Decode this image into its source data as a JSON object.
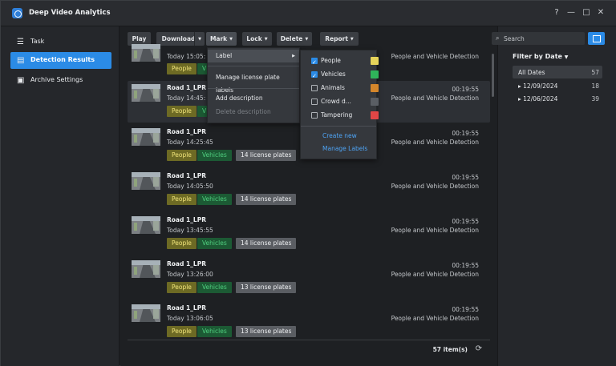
{
  "window": {
    "title": "Deep Video Analytics",
    "help": "?",
    "minimize": "—",
    "maximize": "□",
    "close": "✕"
  },
  "sidebar": {
    "items": [
      {
        "label": "Task",
        "icon": "list-icon"
      },
      {
        "label": "Detection Results",
        "icon": "document-icon",
        "active": true
      },
      {
        "label": "Archive Settings",
        "icon": "archive-icon"
      }
    ]
  },
  "toolbar": {
    "play": "Play",
    "download": "Download",
    "mark": "Mark",
    "lock": "Lock",
    "delete": "Delete",
    "report": "Report"
  },
  "search": {
    "placeholder": "Search"
  },
  "events": [
    {
      "title": "",
      "time": "Today 15:05:",
      "duration": "",
      "type": "People and Vehicle Detection",
      "people": "People",
      "vehicles": "V",
      "plates": ""
    },
    {
      "title": "Road 1_LPR",
      "time": "Today 14:45:",
      "duration": "00:19:55",
      "type": "People and Vehicle Detection",
      "people": "People",
      "vehicles": "V",
      "plates": ""
    },
    {
      "title": "Road 1_LPR",
      "time": "Today 14:25:45",
      "duration": "00:19:55",
      "type": "People and Vehicle Detection",
      "people": "People",
      "vehicles": "Vehicles",
      "plates": "14 license plates"
    },
    {
      "title": "Road 1_LPR",
      "time": "Today 14:05:50",
      "duration": "00:19:55",
      "type": "People and Vehicle Detection",
      "people": "People",
      "vehicles": "Vehicles",
      "plates": "14 license plates"
    },
    {
      "title": "Road 1_LPR",
      "time": "Today 13:45:55",
      "duration": "00:19:55",
      "type": "People and Vehicle Detection",
      "people": "People",
      "vehicles": "Vehicles",
      "plates": "14 license plates"
    },
    {
      "title": "Road 1_LPR",
      "time": "Today 13:26:00",
      "duration": "00:19:55",
      "type": "People and Vehicle Detection",
      "people": "People",
      "vehicles": "Vehicles",
      "plates": "13 license plates"
    },
    {
      "title": "Road 1_LPR",
      "time": "Today 13:06:05",
      "duration": "00:19:55",
      "type": "People and Vehicle Detection",
      "people": "People",
      "vehicles": "Vehicles",
      "plates": "13 license plates"
    }
  ],
  "footer": {
    "count": "57 item(s)"
  },
  "filter": {
    "title": "Filter by Date",
    "dates": [
      {
        "label": "All Dates",
        "count": "57",
        "active": true
      },
      {
        "label": "▸ 12/09/2024",
        "count": "18"
      },
      {
        "label": "▸ 12/06/2024",
        "count": "39"
      }
    ]
  },
  "mark_menu": {
    "label": "Label",
    "manage_plates": "Manage license plate labels",
    "add_description": "Add description",
    "delete_description": "Delete description"
  },
  "label_menu": {
    "items": [
      {
        "name": "People",
        "checked": true,
        "color": "#e6d35a"
      },
      {
        "name": "Vehicles",
        "checked": true,
        "color": "#2fb45a"
      },
      {
        "name": "Animals",
        "checked": false,
        "color": "#d4862b"
      },
      {
        "name": "Crowd d...",
        "checked": false,
        "color": "#5a5e64"
      },
      {
        "name": "Tampering",
        "checked": false,
        "color": "#e04646"
      }
    ],
    "create_new": "Create new",
    "manage_labels": "Manage Labels"
  },
  "colors": {
    "accent": "#2b8be6"
  }
}
